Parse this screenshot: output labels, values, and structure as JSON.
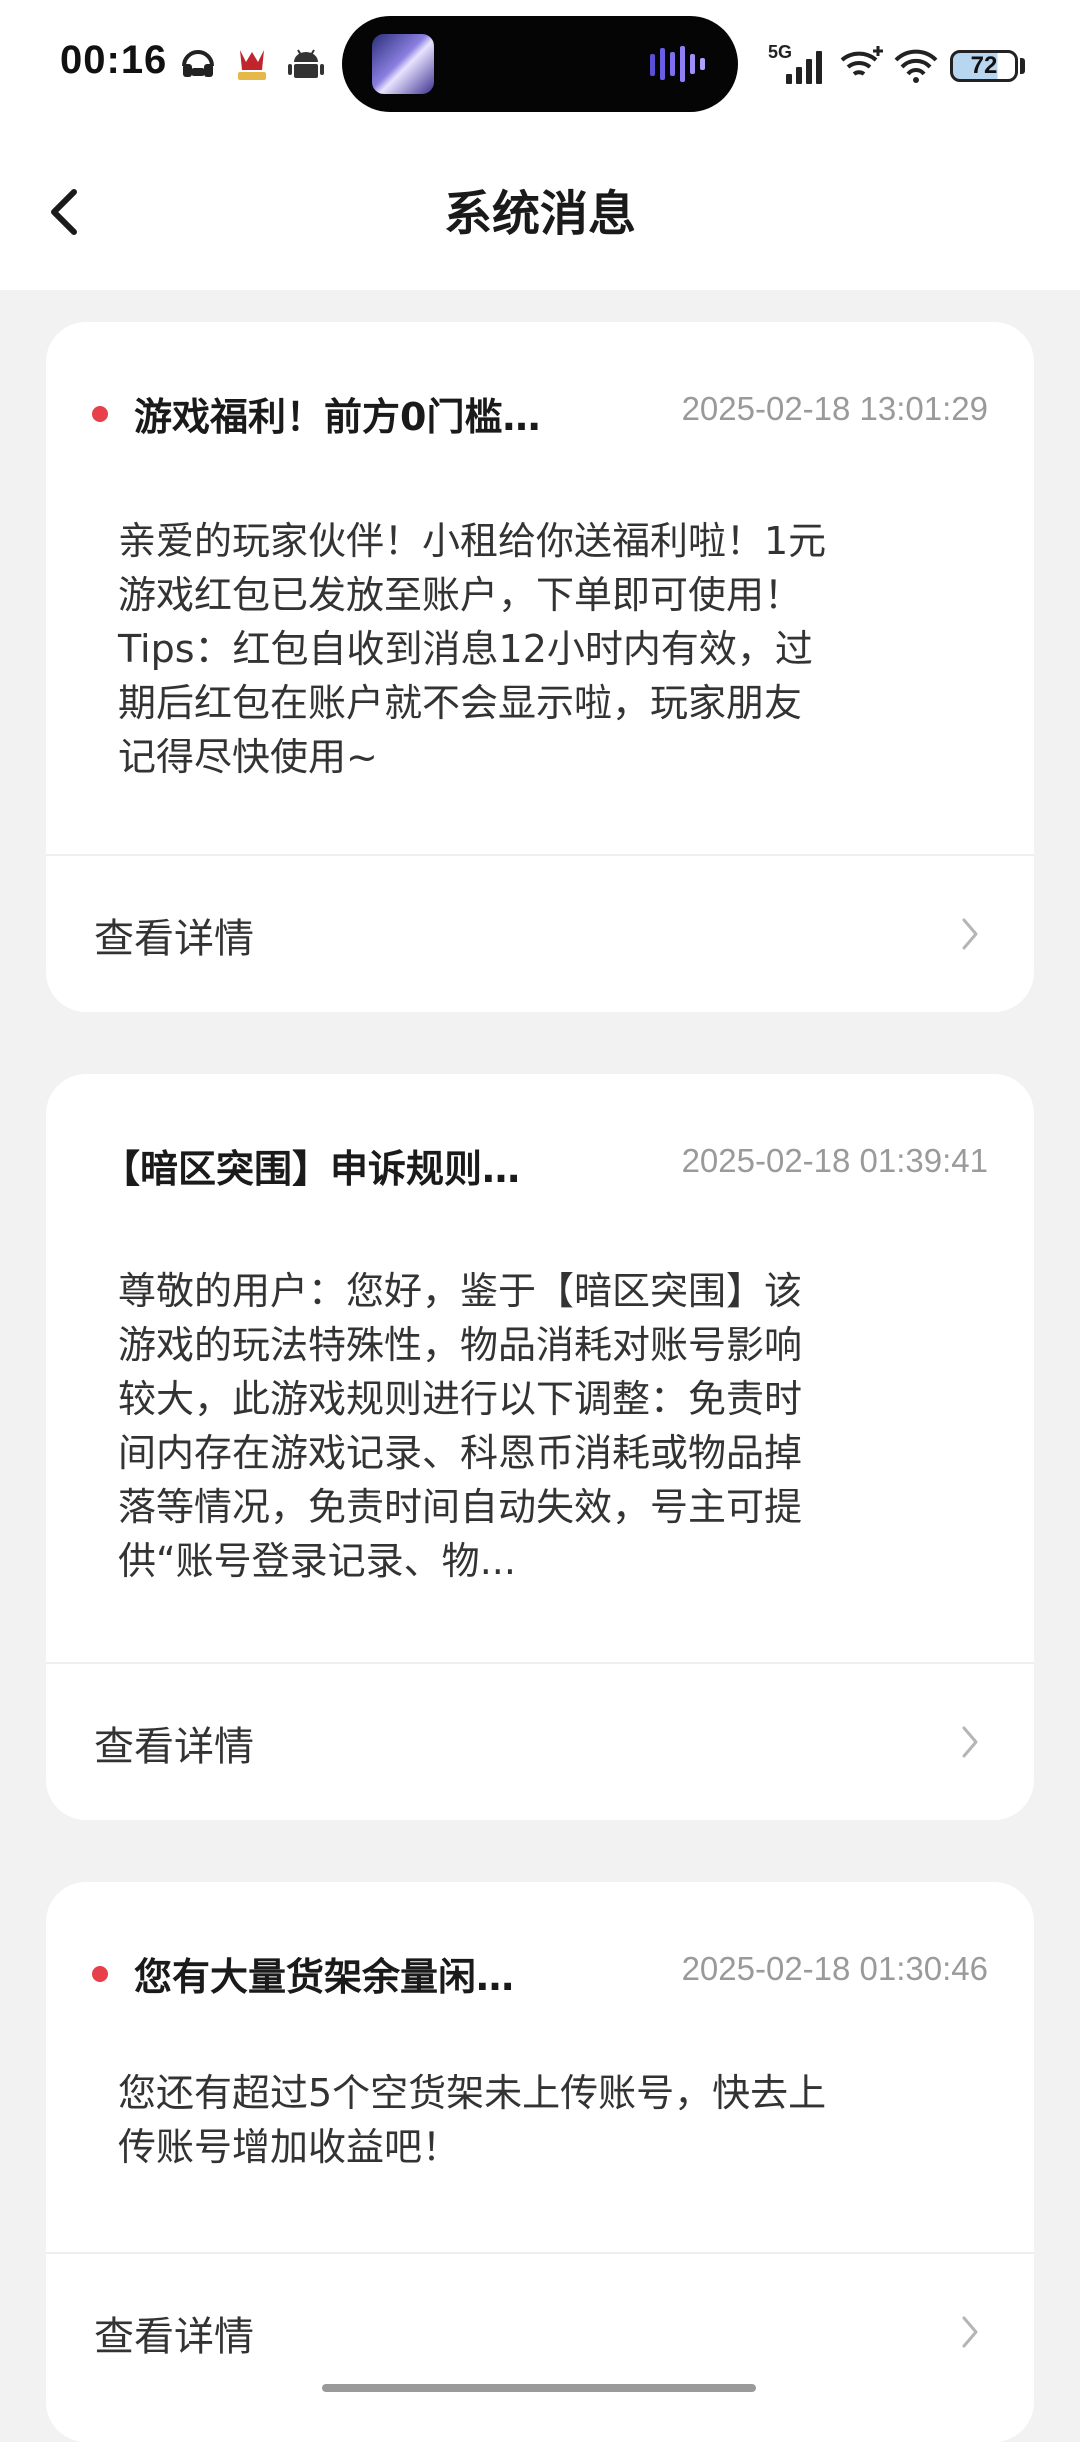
{
  "status_bar": {
    "time": "00:16",
    "network": "5G",
    "battery": "72"
  },
  "header": {
    "title": "系统消息",
    "back_icon": "chevron-left-icon"
  },
  "messages": [
    {
      "unread": true,
      "title": "游戏福利！前方0门槛…",
      "time": "2025-02-18 13:01:29",
      "body": [
        "亲爱的玩家伙伴！小租给你送福利啦！1元",
        "游戏红包已发放至账户，下单即可使用！",
        "Tips：红包自收到消息12小时内有效，过",
        "期后红包在账户就不会显示啦，玩家朋友",
        "记得尽快使用~"
      ],
      "detail_label": "查看详情"
    },
    {
      "unread": false,
      "title": "【暗区突围】申诉规则…",
      "time": "2025-02-18 01:39:41",
      "body": [
        "尊敬的用户：您好，鉴于【暗区突围】该",
        "游戏的玩法特殊性，物品消耗对账号影响",
        "较大，此游戏规则进行以下调整：免责时",
        "间内存在游戏记录、科恩币消耗或物品掉",
        "落等情况，免责时间自动失效，号主可提",
        "供“账号登录记录、物..."
      ],
      "detail_label": "查看详情"
    },
    {
      "unread": true,
      "title": "您有大量货架余量闲…",
      "time": "2025-02-18 01:30:46",
      "body": [
        "您还有超过5个空货架未上传账号，快去上",
        "传账号增加收益吧！"
      ],
      "detail_label": "查看详情"
    }
  ],
  "colors": {
    "unread_dot": "#e8404a",
    "page_background": "#f2f2f2",
    "timestamp": "#9a9a9a"
  }
}
